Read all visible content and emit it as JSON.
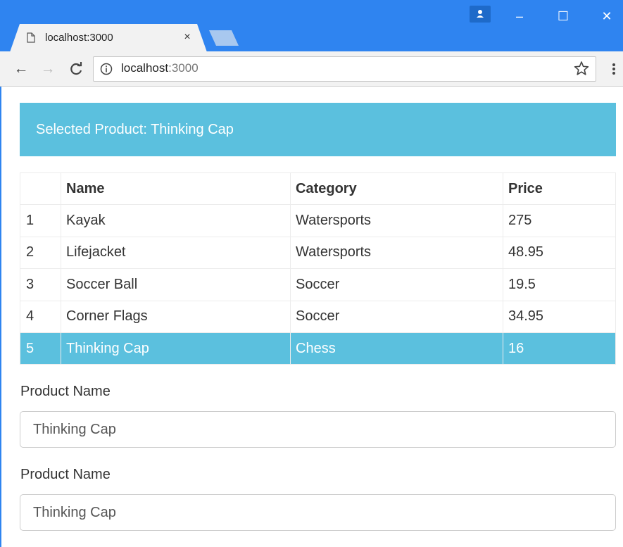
{
  "browser": {
    "tab_title": "localhost:3000",
    "tab_close": "×",
    "url_host": "localhost",
    "url_port": ":3000",
    "window_minimize": "–",
    "window_maximize": "☐",
    "window_close": "✕",
    "nav_back": "←",
    "nav_forward": "→",
    "nav_reload": "C",
    "icons": [
      "page-icon",
      "profile-icon",
      "back-arrow-icon",
      "forward-arrow-icon",
      "reload-icon",
      "info-icon",
      "star-icon",
      "menu-icon"
    ],
    "accent_color": "#2f84f0"
  },
  "banner": {
    "text": "Selected Product: Thinking Cap",
    "color": "#5bc0de"
  },
  "table": {
    "headers": [
      "",
      "Name",
      "Category",
      "Price"
    ],
    "rows": [
      {
        "index": "1",
        "name": "Kayak",
        "category": "Watersports",
        "price": "275",
        "selected": false
      },
      {
        "index": "2",
        "name": "Lifejacket",
        "category": "Watersports",
        "price": "48.95",
        "selected": false
      },
      {
        "index": "3",
        "name": "Soccer Ball",
        "category": "Soccer",
        "price": "19.5",
        "selected": false
      },
      {
        "index": "4",
        "name": "Corner Flags",
        "category": "Soccer",
        "price": "34.95",
        "selected": false
      },
      {
        "index": "5",
        "name": "Thinking Cap",
        "category": "Chess",
        "price": "16",
        "selected": true
      }
    ],
    "selected_color": "#5bc0de"
  },
  "form": {
    "fields": [
      {
        "label": "Product Name",
        "value": "Thinking Cap"
      },
      {
        "label": "Product Name",
        "value": "Thinking Cap"
      }
    ]
  }
}
